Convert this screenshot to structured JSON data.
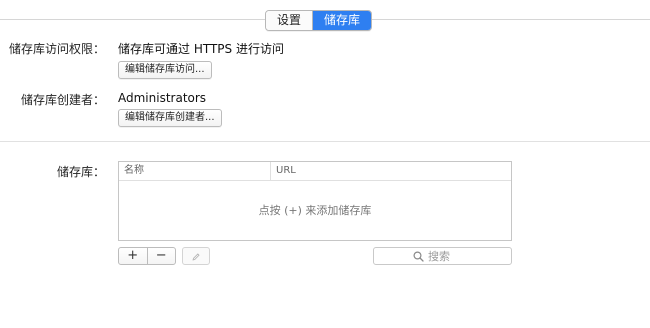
{
  "tabs": [
    {
      "label": "设置",
      "active": false
    },
    {
      "label": "储存库",
      "active": true
    }
  ],
  "access": {
    "label": "储存库访问权限：",
    "value": "储存库可通过 HTTPS 进行访问",
    "button": "编辑储存库访问..."
  },
  "creator": {
    "label": "储存库创建者：",
    "value": "Administrators",
    "button": "编辑储存库创建者..."
  },
  "repositories": {
    "label": "储存库：",
    "columns": [
      "名称",
      "URL"
    ],
    "rows": [],
    "empty_message": "点按 (+) 来添加储存库",
    "add_label": "+",
    "remove_label": "−",
    "search_placeholder": "搜索"
  },
  "icons": {
    "search": "magnifier-icon",
    "edit": "pencil-icon"
  },
  "colors": {
    "accent": "#2e7ff1"
  }
}
